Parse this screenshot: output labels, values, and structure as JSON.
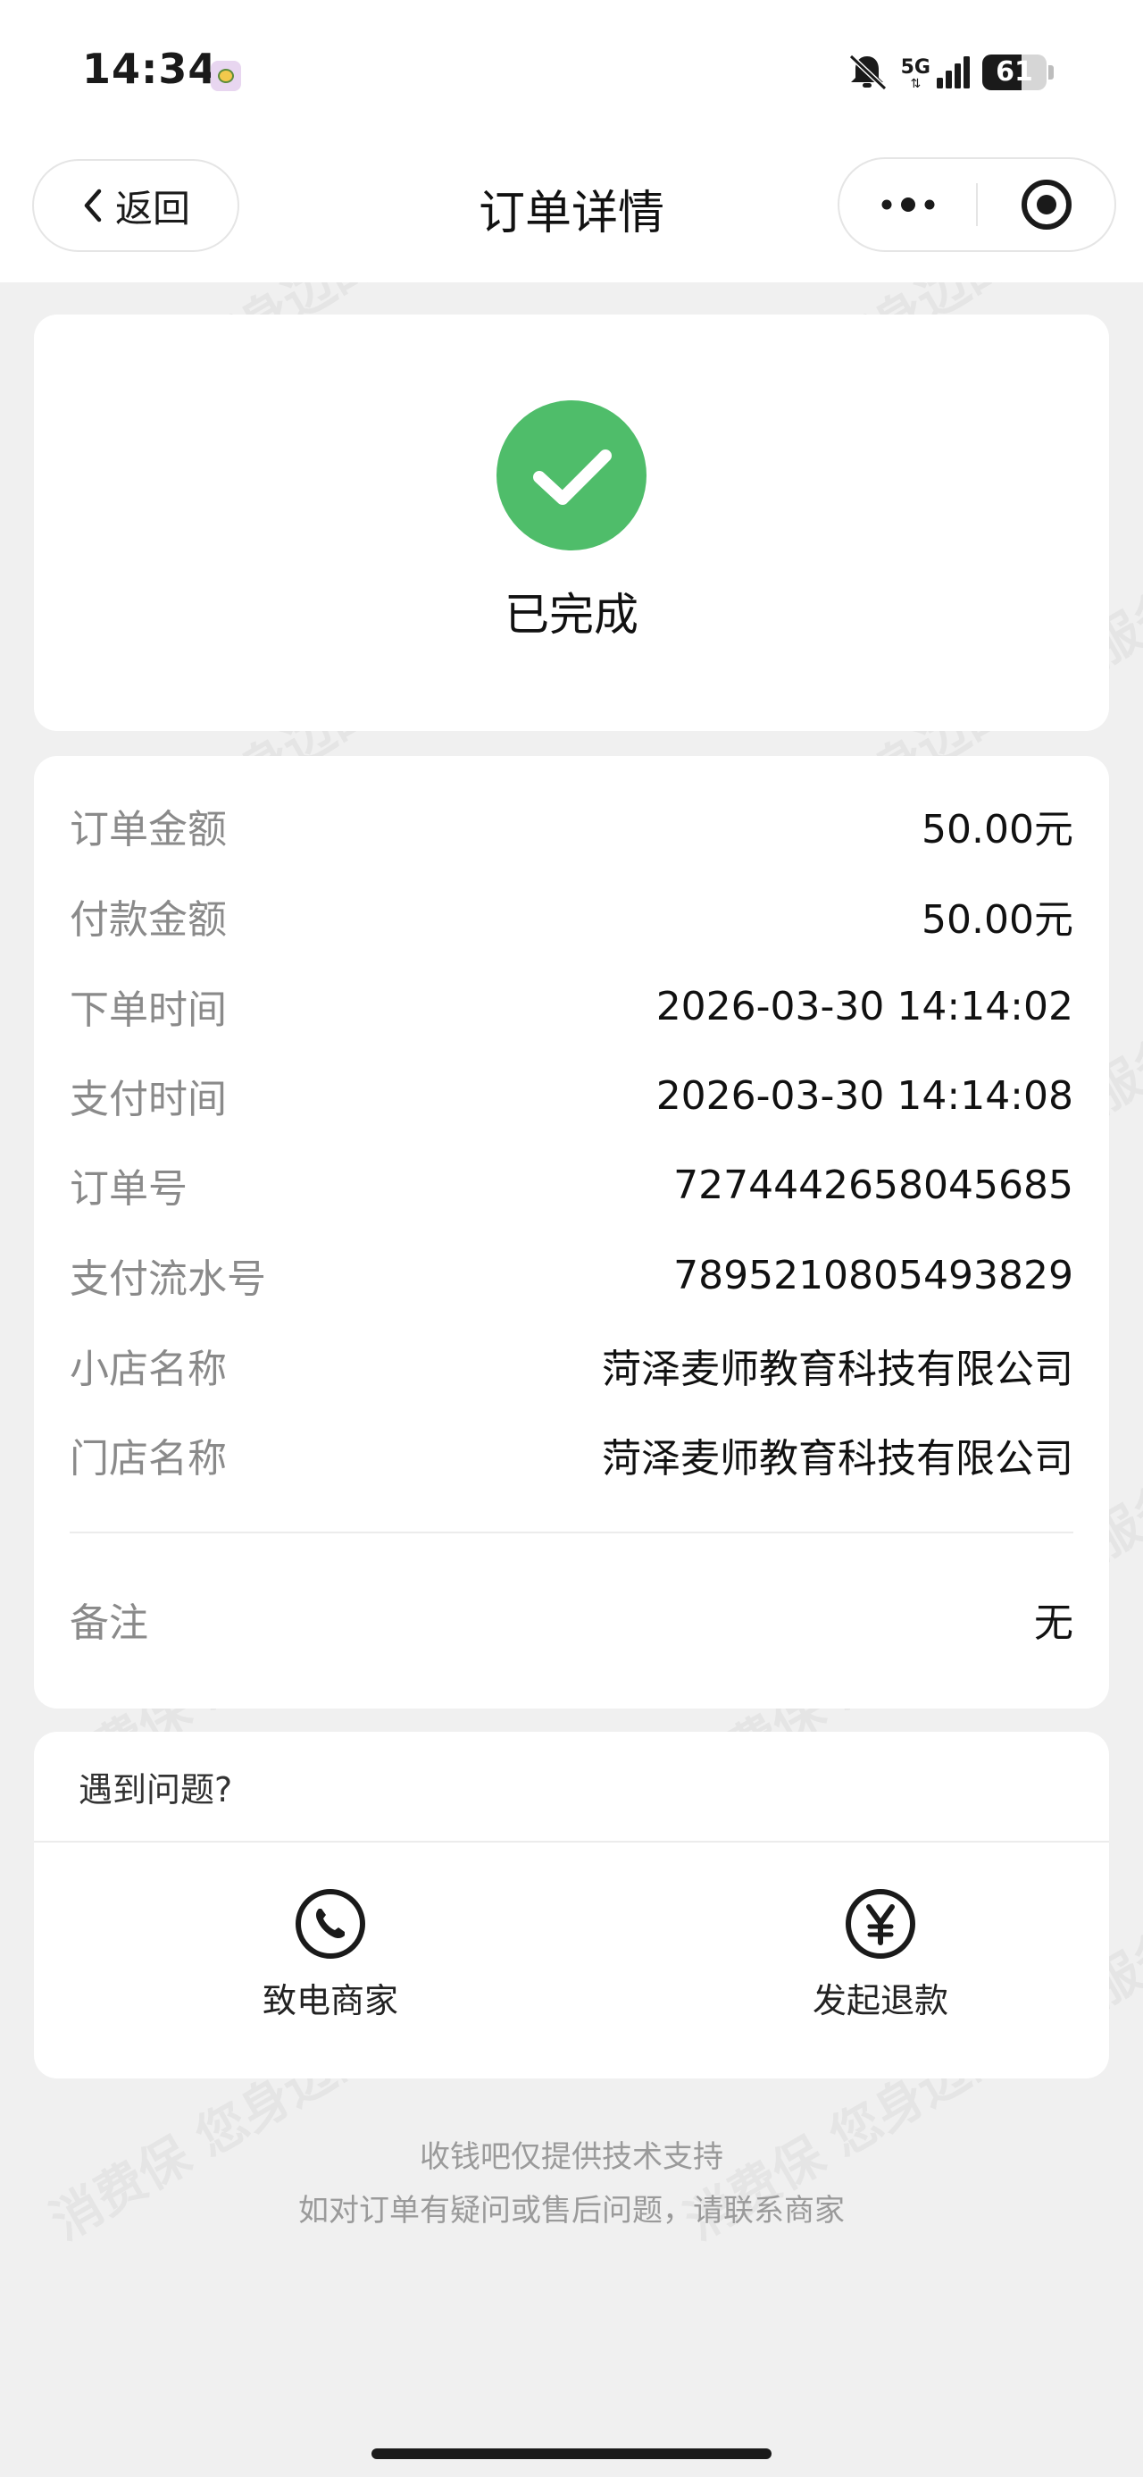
{
  "status_bar": {
    "time": "14:34",
    "network": "5G",
    "battery": "61",
    "battery_level": 0.61
  },
  "nav": {
    "back_label": "返回",
    "title": "订单详情"
  },
  "order_status": {
    "label": "已完成"
  },
  "details": [
    {
      "key": "订单金额",
      "value": "50.00元"
    },
    {
      "key": "付款金额",
      "value": "50.00元"
    },
    {
      "key": "下单时间",
      "value": "2026-03-30 14:14:02"
    },
    {
      "key": "支付时间",
      "value": "2026-03-30 14:14:08"
    },
    {
      "key": "订单号",
      "value": "7274442658045685"
    },
    {
      "key": "支付流水号",
      "value": "7895210805493829"
    },
    {
      "key": "小店名称",
      "value": "菏泽麦师教育科技有限公司"
    },
    {
      "key": "门店名称",
      "value": "菏泽麦师教育科技有限公司"
    }
  ],
  "remark": {
    "key": "备注",
    "value": "无"
  },
  "help": {
    "title": "遇到问题?",
    "call_label": "致电商家",
    "refund_label": "发起退款"
  },
  "footer": {
    "line1": "收钱吧仅提供技术支持",
    "line2": "如对订单有疑问或售后问题，请联系商家"
  },
  "watermark": {
    "text": "消费保 您身边的消费服务管家"
  },
  "colors": {
    "success": "#4fbd6a",
    "background": "#f0f0f0",
    "label": "#8a8a8a"
  }
}
